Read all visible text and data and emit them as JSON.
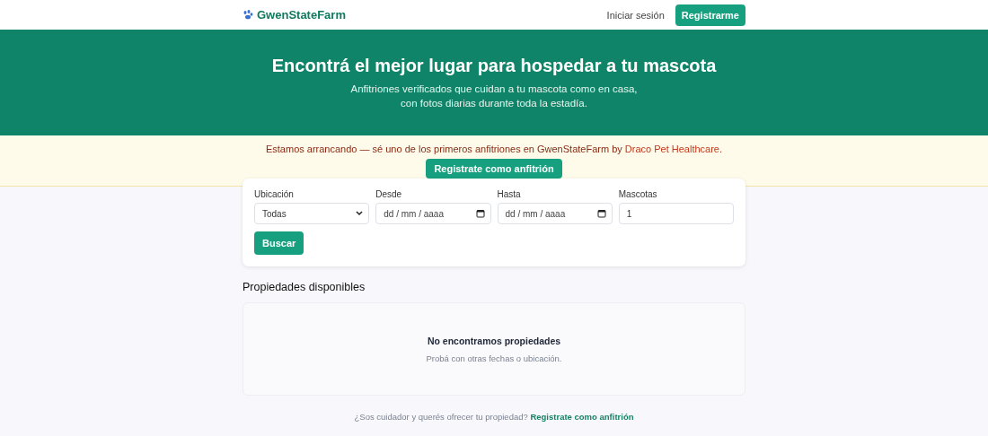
{
  "header": {
    "brand": "GwenStateFarm",
    "login": "Iniciar sesión",
    "register": "Registrarme"
  },
  "hero": {
    "title": "Encontrá el mejor lugar para hospedar a tu mascota",
    "subtitle": "Anfitriones verificados que cuidan a tu mascota como en casa, con fotos diarias durante toda la estadía."
  },
  "banner": {
    "text": "Estamos arrancando — sé uno de los primeros anfitriones en GwenStateFarm by ",
    "link": "Draco Pet Healthcare.",
    "button": "Registrate como anfitrión"
  },
  "search": {
    "fields": [
      {
        "kind": "select",
        "label": "Ubicación",
        "value": "Todas"
      },
      {
        "kind": "date",
        "label": "Desde",
        "placeholder": "dd / mm / aaaa"
      },
      {
        "kind": "date",
        "label": "Hasta",
        "placeholder": "dd / mm / aaaa"
      },
      {
        "kind": "number",
        "label": "Mascotas",
        "value": "1"
      }
    ],
    "button": "Buscar"
  },
  "results": {
    "title": "Propiedades disponibles",
    "empty_title": "No encontramos propiedades",
    "empty_hint": "Probá con otras fechas o ubicación."
  },
  "footer": {
    "text": "¿Sos cuidador y querés ofrecer tu propiedad?",
    "link": "Registrate como anfitrión"
  }
}
